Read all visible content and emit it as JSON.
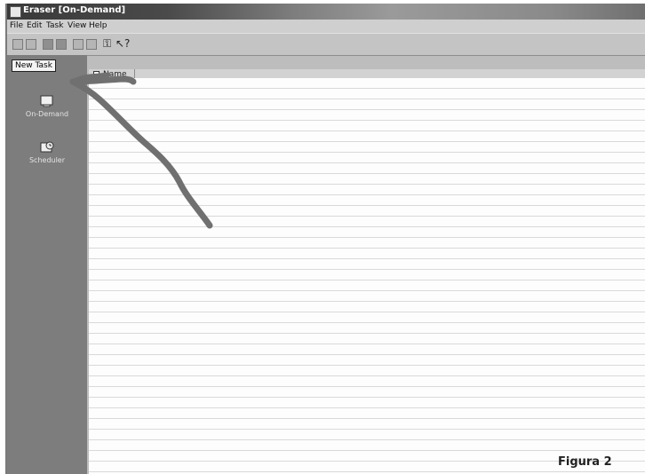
{
  "window": {
    "title": "Eraser [On-Demand]"
  },
  "menu": {
    "items": [
      "File",
      "Edit",
      "Task",
      "View",
      "Help"
    ]
  },
  "toolbar": {
    "tooltip": "New Task"
  },
  "sidebar": {
    "items": [
      {
        "label": "On-Demand",
        "icon": "on-demand-icon"
      },
      {
        "label": "Scheduler",
        "icon": "scheduler-icon"
      }
    ]
  },
  "list": {
    "columns": [
      "Name"
    ]
  },
  "annotation": {
    "color": "#707070",
    "shape": "hand-drawn arrow pointing to New Task button"
  },
  "figure": {
    "caption": "Figura 2"
  }
}
